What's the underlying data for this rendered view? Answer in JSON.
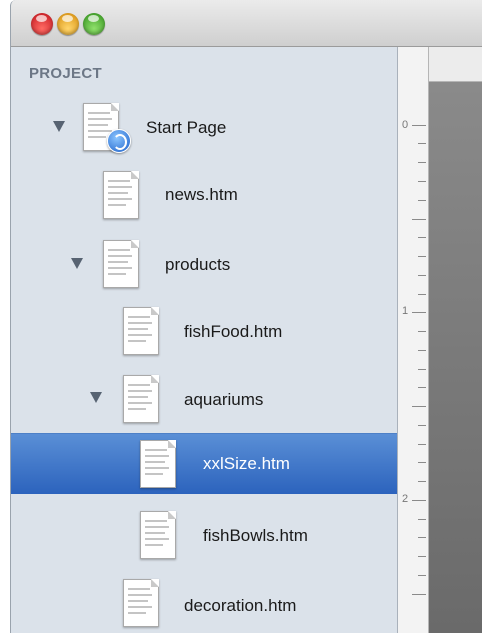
{
  "window": {
    "controls": [
      "close",
      "minimize",
      "zoom"
    ]
  },
  "sidebar": {
    "section_header": "PROJECT",
    "items": [
      {
        "label": "Start Page",
        "expanded": true,
        "icon": "start-page-icon"
      },
      {
        "label": "news.htm",
        "icon": "page-icon"
      },
      {
        "label": "products",
        "expanded": true,
        "icon": "page-icon"
      },
      {
        "label": "fishFood.htm",
        "icon": "page-icon"
      },
      {
        "label": "aquariums",
        "expanded": true,
        "icon": "page-icon"
      },
      {
        "label": "xxlSize.htm",
        "selected": true,
        "icon": "page-icon"
      },
      {
        "label": "fishBowls.htm",
        "icon": "page-icon"
      },
      {
        "label": "decoration.htm",
        "icon": "page-icon"
      }
    ]
  },
  "ruler": {
    "labels": [
      "0",
      "1",
      "2"
    ]
  },
  "colors": {
    "selection": "#2c63bd",
    "sidebar_bg": "#dbe2ea",
    "header_text": "#6c7786"
  }
}
